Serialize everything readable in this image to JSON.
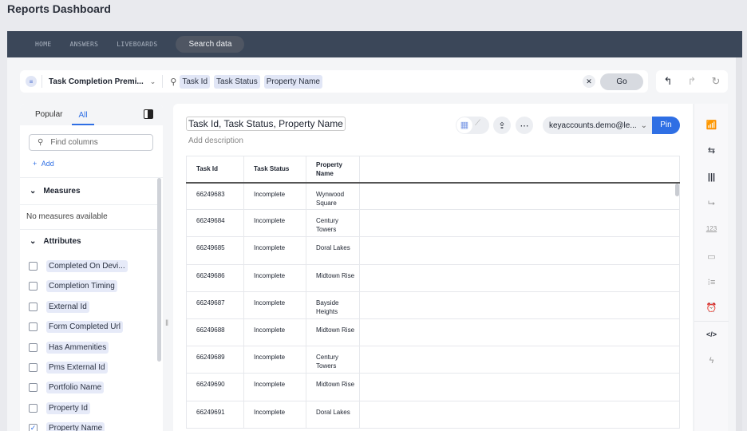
{
  "app": {
    "title": "Reports Dashboard"
  },
  "nav": {
    "items": [
      "HOME",
      "ANSWERS",
      "LIVEBOARDS"
    ],
    "search_data": "Search data"
  },
  "searchbar": {
    "source": "Task Completion Premi...",
    "tokens": [
      "Task Id",
      "Task Status",
      "Property Name"
    ],
    "go": "Go"
  },
  "left": {
    "tabs": [
      "Popular",
      "All"
    ],
    "active_tab": "All",
    "find_placeholder": "Find columns",
    "add": "Add",
    "measures": "Measures",
    "no_measures": "No measures available",
    "attributes": "Attributes",
    "items": [
      {
        "label": "Completed On Devi...",
        "checked": false
      },
      {
        "label": "Completion Timing",
        "checked": false
      },
      {
        "label": "External Id",
        "checked": false
      },
      {
        "label": "Form Completed Url",
        "checked": false
      },
      {
        "label": "Has Ammenities",
        "checked": false
      },
      {
        "label": "Pms External Id",
        "checked": false
      },
      {
        "label": "Portfolio Name",
        "checked": false
      },
      {
        "label": "Property Id",
        "checked": false
      },
      {
        "label": "Property Name",
        "checked": true
      }
    ]
  },
  "main": {
    "answer_title": "Task Id, Task Status, Property Name",
    "add_description": "Add description",
    "user": "keyaccounts.demo@le...",
    "pin": "Pin",
    "columns": [
      "Task Id",
      "Task Status",
      "Property Name"
    ],
    "rows": [
      [
        "66249683",
        "Incomplete",
        "Wynwood Square"
      ],
      [
        "66249684",
        "Incomplete",
        "Century Towers"
      ],
      [
        "66249685",
        "Incomplete",
        "Doral Lakes"
      ],
      [
        "66249686",
        "Incomplete",
        "Midtown Rise"
      ],
      [
        "66249687",
        "Incomplete",
        "Bayside Heights"
      ],
      [
        "66249688",
        "Incomplete",
        "Midtown Rise"
      ],
      [
        "66249689",
        "Incomplete",
        "Century Towers"
      ],
      [
        "66249690",
        "Incomplete",
        "Midtown Rise"
      ],
      [
        "66249691",
        "Incomplete",
        "Doral Lakes"
      ]
    ]
  },
  "colors": {
    "accent": "#2f6fe4",
    "nav_bg": "#3b4759"
  }
}
